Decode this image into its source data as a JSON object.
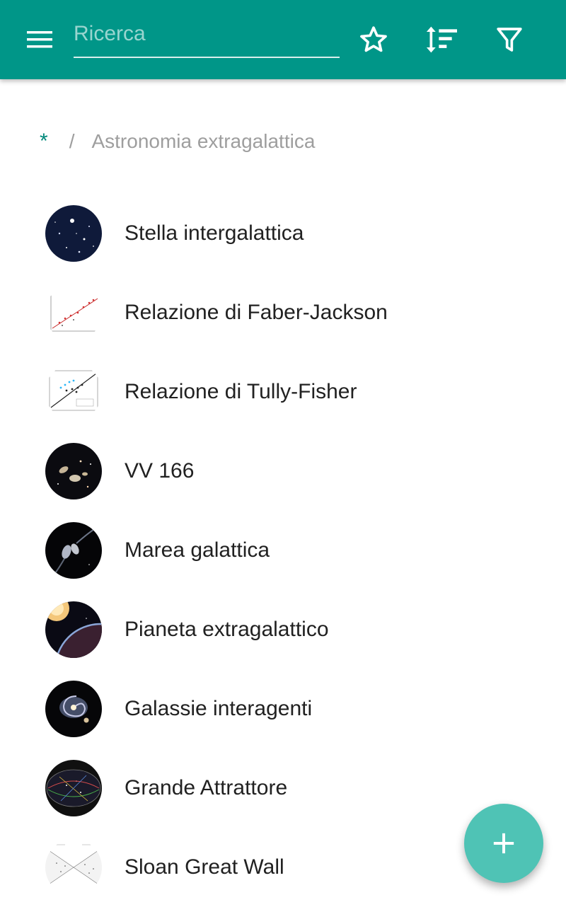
{
  "toolbar": {
    "menu_icon": "menu-icon",
    "search_placeholder": "Ricerca",
    "search_value": "",
    "favorites_icon": "star-outline-icon",
    "sort_icon": "sort-icon",
    "filter_icon": "filter-icon",
    "accent_color": "#009688"
  },
  "breadcrumb": {
    "root": "*",
    "separator": "/",
    "current": "Astronomia extragalattica"
  },
  "items": [
    {
      "label": "Stella intergalattica",
      "thumb": "star-field"
    },
    {
      "label": "Relazione di Faber-Jackson",
      "thumb": "scatter-plot"
    },
    {
      "label": "Relazione di Tully-Fisher",
      "thumb": "scatter-plot-blue"
    },
    {
      "label": "VV 166",
      "thumb": "galaxy-group"
    },
    {
      "label": "Marea galattica",
      "thumb": "colliding-galaxies"
    },
    {
      "label": "Pianeta extragalattico",
      "thumb": "planet"
    },
    {
      "label": "Galassie interagenti",
      "thumb": "spiral-galaxy"
    },
    {
      "label": "Grande Attrattore",
      "thumb": "sky-map"
    },
    {
      "label": "Sloan Great Wall",
      "thumb": "survey-diagram"
    }
  ],
  "fab": {
    "icon": "add-icon",
    "color": "#4fc3b5"
  }
}
